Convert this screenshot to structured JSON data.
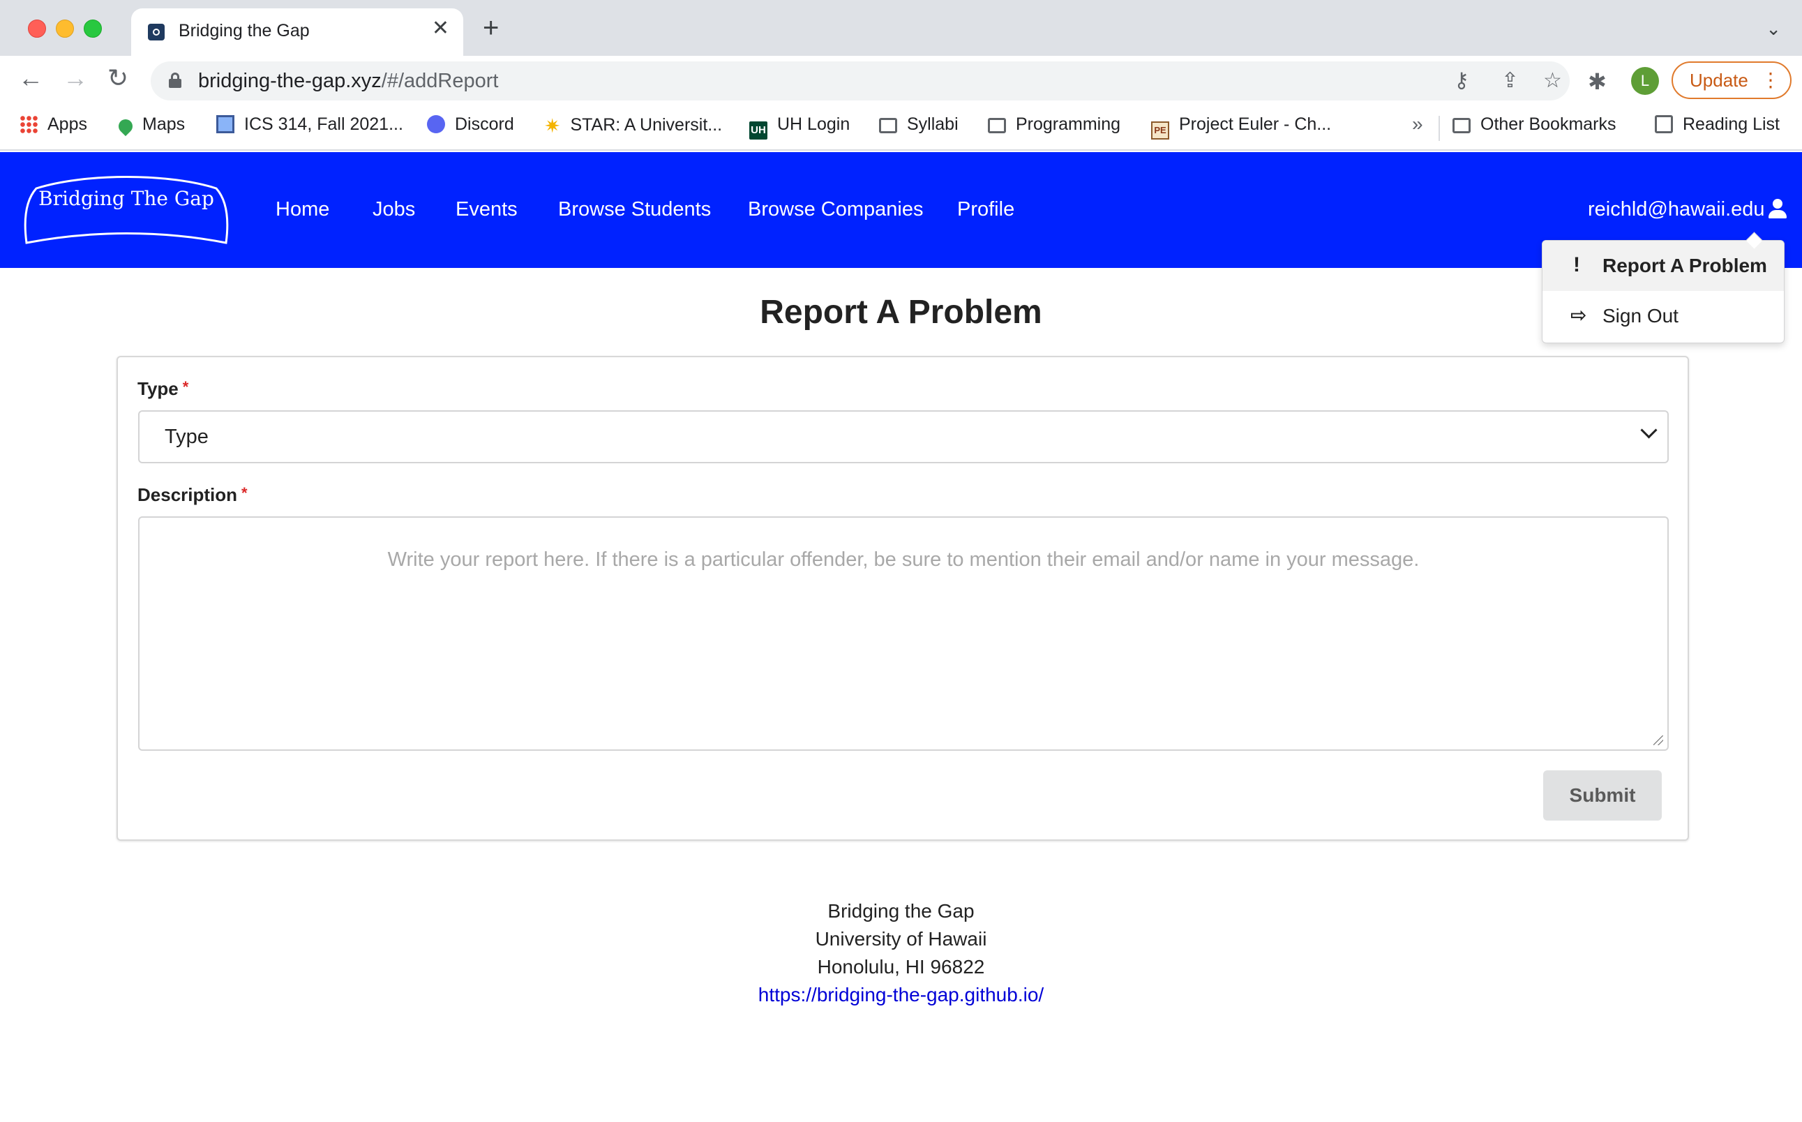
{
  "browser": {
    "tab_title": "Bridging the Gap",
    "url_host": "bridging-the-gap.xyz",
    "url_path": "/#/addReport",
    "avatar_letter": "L",
    "update_label": "Update",
    "bookmarks": [
      {
        "label": "Apps",
        "icon": "apps-grid-icon"
      },
      {
        "label": "Maps",
        "icon": "maps-pin-icon"
      },
      {
        "label": "ICS 314, Fall 2021...",
        "icon": "ics-square-icon"
      },
      {
        "label": "Discord",
        "icon": "discord-icon"
      },
      {
        "label": "STAR: A Universit...",
        "icon": "star-icon"
      },
      {
        "label": "UH Login",
        "icon": "uh-icon"
      },
      {
        "label": "Syllabi",
        "icon": "folder-icon"
      },
      {
        "label": "Programming",
        "icon": "folder-icon"
      },
      {
        "label": "Project Euler - Ch...",
        "icon": "project-euler-icon"
      }
    ],
    "other_bookmarks": "Other Bookmarks",
    "reading_list": "Reading List"
  },
  "navbar": {
    "logo_text": "Bridging The Gap",
    "links": [
      "Home",
      "Jobs",
      "Events",
      "Browse Students",
      "Browse Companies",
      "Profile"
    ],
    "user_email": "reichld@hawaii.edu",
    "brand_color": "#0022ff"
  },
  "dropdown": {
    "items": [
      {
        "label": "Report A Problem",
        "icon": "exclamation-icon"
      },
      {
        "label": "Sign Out",
        "icon": "sign-out-icon"
      }
    ]
  },
  "form": {
    "title": "Report A Problem",
    "type_label": "Type",
    "type_value": "Type",
    "description_label": "Description",
    "description_placeholder": "Write your report here. If there is a particular offender, be sure to mention their email and/or name in your message.",
    "required_mark": "*",
    "submit_label": "Submit"
  },
  "footer": {
    "line1": "Bridging the Gap",
    "line2": "University of Hawaii",
    "line3": "Honolulu, HI 96822",
    "link": "https://bridging-the-gap.github.io/"
  }
}
